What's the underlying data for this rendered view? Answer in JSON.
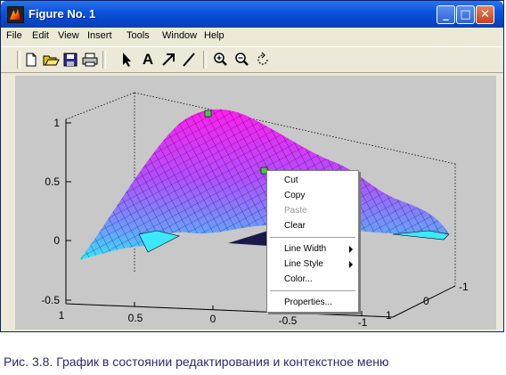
{
  "window": {
    "title": "Figure No. 1",
    "buttons": {
      "minimize": "_",
      "maximize": "□",
      "close": "✕"
    }
  },
  "menubar": {
    "items": [
      "File",
      "Edit",
      "View",
      "Insert",
      "Tools",
      "Window",
      "Help"
    ]
  },
  "toolbar": {
    "tools": [
      "new-file-icon",
      "open-folder-icon",
      "save-icon",
      "print-icon",
      "select-arrow-icon",
      "text-icon",
      "arrow-icon",
      "line-icon",
      "zoom-in-icon",
      "zoom-out-icon",
      "rotate-icon"
    ],
    "text_tool": "A"
  },
  "plot": {
    "z_ticks": [
      "1",
      "0.5",
      "0",
      "-0.5"
    ],
    "x_ticks": [
      "1",
      "0.5",
      "0",
      "-0.5",
      "-1"
    ],
    "y_ticks": [
      "-1",
      "0",
      "1"
    ],
    "colormap": "cool"
  },
  "context_menu": {
    "items": [
      {
        "label": "Cut",
        "enabled": true
      },
      {
        "label": "Copy",
        "enabled": true
      },
      {
        "label": "Paste",
        "enabled": false
      },
      {
        "label": "Clear",
        "enabled": true
      },
      {
        "label": "Line Width",
        "enabled": true,
        "submenu": true
      },
      {
        "label": "Line Style",
        "enabled": true,
        "submenu": true
      },
      {
        "label": "Color...",
        "enabled": true
      },
      {
        "label": "Properties...",
        "enabled": true
      }
    ]
  },
  "caption": {
    "lead": "Рис. 3.8.",
    "text": "График в состоянии редактирования и контекстное меню"
  }
}
